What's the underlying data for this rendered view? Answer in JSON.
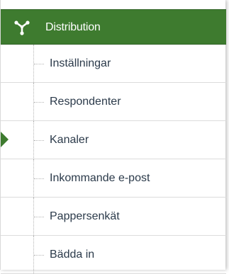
{
  "nav": {
    "header": {
      "title": "Distribution",
      "icon": "distribution-icon"
    },
    "items": [
      {
        "label": "Inställningar",
        "active": false
      },
      {
        "label": "Respondenter",
        "active": false
      },
      {
        "label": "Kanaler",
        "active": true
      },
      {
        "label": "Inkommande e-post",
        "active": false
      },
      {
        "label": "Pappersenkät",
        "active": false
      },
      {
        "label": "Bädda in",
        "active": false
      }
    ]
  },
  "colors": {
    "header_bg": "#3e7b2f",
    "header_text": "#ffffff",
    "item_text": "#2b3a4a",
    "active_marker": "#3e7b2f"
  }
}
